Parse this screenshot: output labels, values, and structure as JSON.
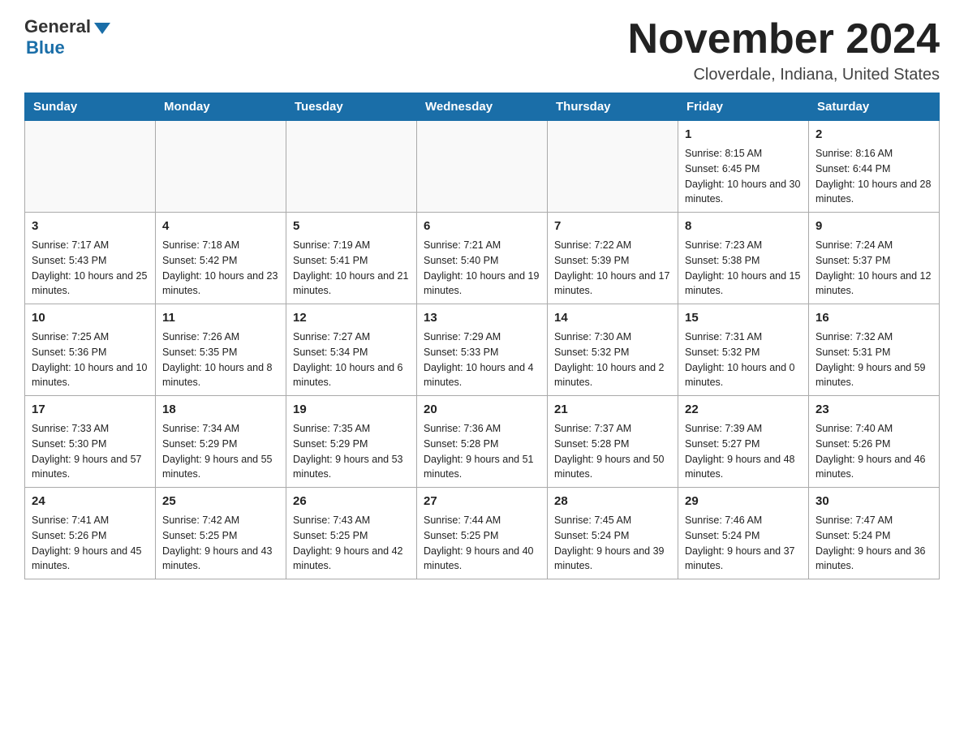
{
  "logo": {
    "general": "General",
    "blue": "Blue"
  },
  "header": {
    "month_title": "November 2024",
    "location": "Cloverdale, Indiana, United States"
  },
  "days_of_week": [
    "Sunday",
    "Monday",
    "Tuesday",
    "Wednesday",
    "Thursday",
    "Friday",
    "Saturday"
  ],
  "weeks": [
    [
      {
        "day": "",
        "info": ""
      },
      {
        "day": "",
        "info": ""
      },
      {
        "day": "",
        "info": ""
      },
      {
        "day": "",
        "info": ""
      },
      {
        "day": "",
        "info": ""
      },
      {
        "day": "1",
        "info": "Sunrise: 8:15 AM\nSunset: 6:45 PM\nDaylight: 10 hours and 30 minutes."
      },
      {
        "day": "2",
        "info": "Sunrise: 8:16 AM\nSunset: 6:44 PM\nDaylight: 10 hours and 28 minutes."
      }
    ],
    [
      {
        "day": "3",
        "info": "Sunrise: 7:17 AM\nSunset: 5:43 PM\nDaylight: 10 hours and 25 minutes."
      },
      {
        "day": "4",
        "info": "Sunrise: 7:18 AM\nSunset: 5:42 PM\nDaylight: 10 hours and 23 minutes."
      },
      {
        "day": "5",
        "info": "Sunrise: 7:19 AM\nSunset: 5:41 PM\nDaylight: 10 hours and 21 minutes."
      },
      {
        "day": "6",
        "info": "Sunrise: 7:21 AM\nSunset: 5:40 PM\nDaylight: 10 hours and 19 minutes."
      },
      {
        "day": "7",
        "info": "Sunrise: 7:22 AM\nSunset: 5:39 PM\nDaylight: 10 hours and 17 minutes."
      },
      {
        "day": "8",
        "info": "Sunrise: 7:23 AM\nSunset: 5:38 PM\nDaylight: 10 hours and 15 minutes."
      },
      {
        "day": "9",
        "info": "Sunrise: 7:24 AM\nSunset: 5:37 PM\nDaylight: 10 hours and 12 minutes."
      }
    ],
    [
      {
        "day": "10",
        "info": "Sunrise: 7:25 AM\nSunset: 5:36 PM\nDaylight: 10 hours and 10 minutes."
      },
      {
        "day": "11",
        "info": "Sunrise: 7:26 AM\nSunset: 5:35 PM\nDaylight: 10 hours and 8 minutes."
      },
      {
        "day": "12",
        "info": "Sunrise: 7:27 AM\nSunset: 5:34 PM\nDaylight: 10 hours and 6 minutes."
      },
      {
        "day": "13",
        "info": "Sunrise: 7:29 AM\nSunset: 5:33 PM\nDaylight: 10 hours and 4 minutes."
      },
      {
        "day": "14",
        "info": "Sunrise: 7:30 AM\nSunset: 5:32 PM\nDaylight: 10 hours and 2 minutes."
      },
      {
        "day": "15",
        "info": "Sunrise: 7:31 AM\nSunset: 5:32 PM\nDaylight: 10 hours and 0 minutes."
      },
      {
        "day": "16",
        "info": "Sunrise: 7:32 AM\nSunset: 5:31 PM\nDaylight: 9 hours and 59 minutes."
      }
    ],
    [
      {
        "day": "17",
        "info": "Sunrise: 7:33 AM\nSunset: 5:30 PM\nDaylight: 9 hours and 57 minutes."
      },
      {
        "day": "18",
        "info": "Sunrise: 7:34 AM\nSunset: 5:29 PM\nDaylight: 9 hours and 55 minutes."
      },
      {
        "day": "19",
        "info": "Sunrise: 7:35 AM\nSunset: 5:29 PM\nDaylight: 9 hours and 53 minutes."
      },
      {
        "day": "20",
        "info": "Sunrise: 7:36 AM\nSunset: 5:28 PM\nDaylight: 9 hours and 51 minutes."
      },
      {
        "day": "21",
        "info": "Sunrise: 7:37 AM\nSunset: 5:28 PM\nDaylight: 9 hours and 50 minutes."
      },
      {
        "day": "22",
        "info": "Sunrise: 7:39 AM\nSunset: 5:27 PM\nDaylight: 9 hours and 48 minutes."
      },
      {
        "day": "23",
        "info": "Sunrise: 7:40 AM\nSunset: 5:26 PM\nDaylight: 9 hours and 46 minutes."
      }
    ],
    [
      {
        "day": "24",
        "info": "Sunrise: 7:41 AM\nSunset: 5:26 PM\nDaylight: 9 hours and 45 minutes."
      },
      {
        "day": "25",
        "info": "Sunrise: 7:42 AM\nSunset: 5:25 PM\nDaylight: 9 hours and 43 minutes."
      },
      {
        "day": "26",
        "info": "Sunrise: 7:43 AM\nSunset: 5:25 PM\nDaylight: 9 hours and 42 minutes."
      },
      {
        "day": "27",
        "info": "Sunrise: 7:44 AM\nSunset: 5:25 PM\nDaylight: 9 hours and 40 minutes."
      },
      {
        "day": "28",
        "info": "Sunrise: 7:45 AM\nSunset: 5:24 PM\nDaylight: 9 hours and 39 minutes."
      },
      {
        "day": "29",
        "info": "Sunrise: 7:46 AM\nSunset: 5:24 PM\nDaylight: 9 hours and 37 minutes."
      },
      {
        "day": "30",
        "info": "Sunrise: 7:47 AM\nSunset: 5:24 PM\nDaylight: 9 hours and 36 minutes."
      }
    ]
  ]
}
